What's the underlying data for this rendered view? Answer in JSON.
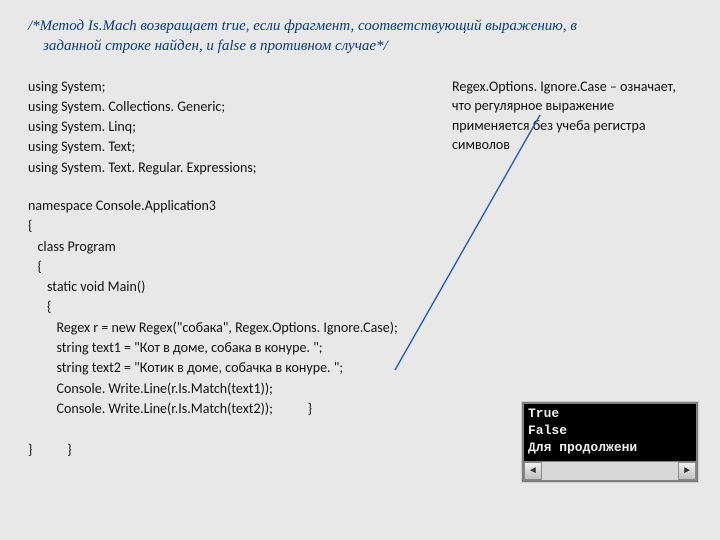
{
  "title_line1": "/*Метод Is.Mach возвращает true, если фрагмент, соответствующий выражению, в",
  "title_line2": "заданной строке найден, и false в противном случае*/",
  "usings": [
    "using System;",
    "using System. Collections. Generic;",
    "using System. Linq;",
    "using System. Text;",
    "using System. Text. Regular. Expressions;"
  ],
  "annotation": "Regex.Options. Ignore.Case – означает, что регулярное выражение применяется без учеба регистра символов",
  "code_body": "namespace Console.Application3\n{\n   class Program\n   {\n      static void Main()\n      {\n         Regex r = new Regex(\"собака\", Regex.Options. Ignore.Case);\n         string text1 = \"Кот в доме, собака в конуре. \";\n         string text2 = \"Котик в доме, собачка в конуре. \";\n         Console. Write.Line(r.Is.Match(text1));\n         Console. Write.Line(r.Is.Match(text2));           }\n\n}           }",
  "console": {
    "line1": "True",
    "line2": "False",
    "line3": "Для продолжени"
  }
}
